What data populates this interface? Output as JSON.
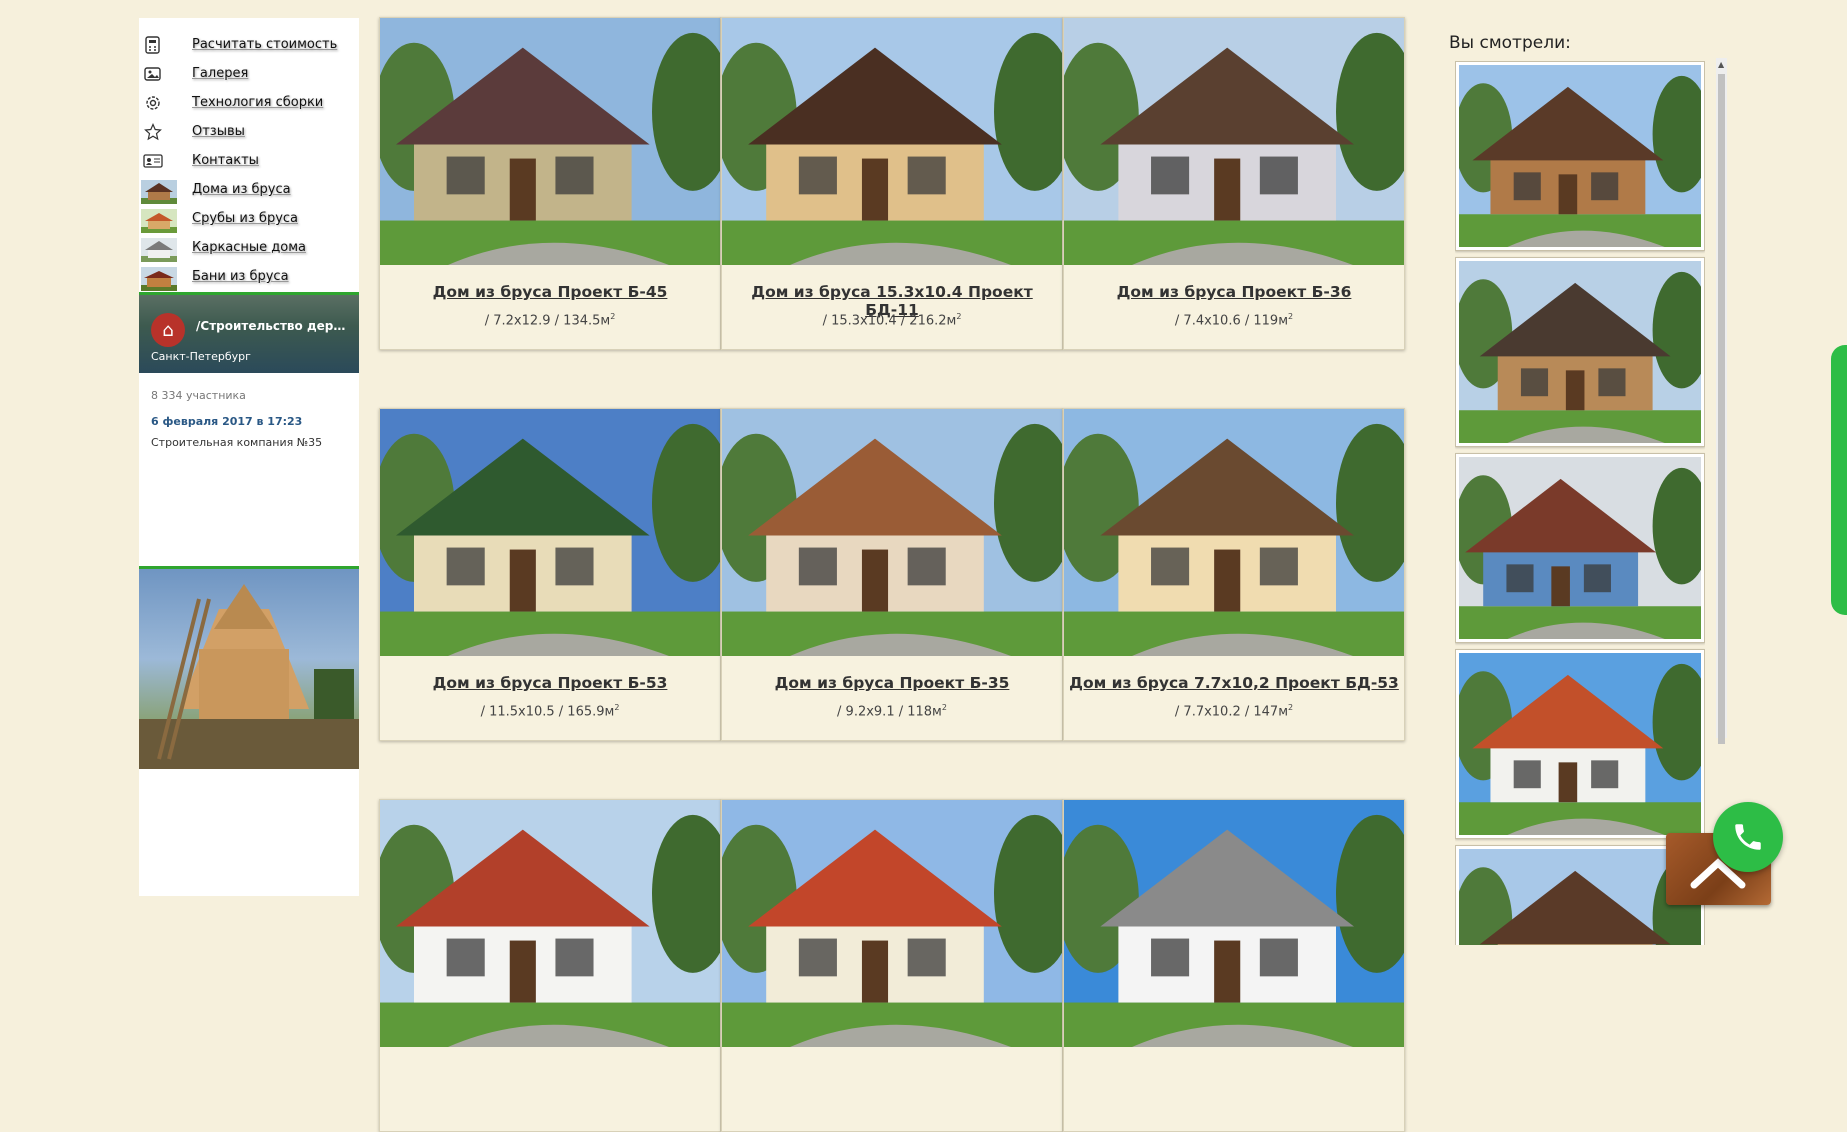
{
  "sidebar": {
    "menu": [
      {
        "label": "Расчитать стоимость",
        "icon": "calculator-icon"
      },
      {
        "label": "Галерея",
        "icon": "gallery-icon"
      },
      {
        "label": "Технология сборки",
        "icon": "gear-icon"
      },
      {
        "label": "Отзывы",
        "icon": "star-icon"
      },
      {
        "label": "Контакты",
        "icon": "contact-card-icon"
      },
      {
        "label": "Дома из бруса",
        "icon": "house-thumb-icon"
      },
      {
        "label": "Срубы из бруса",
        "icon": "house-thumb-icon"
      },
      {
        "label": "Каркасные дома",
        "icon": "house-thumb-icon"
      },
      {
        "label": "Бани из бруса",
        "icon": "house-thumb-icon"
      }
    ],
    "vk_widget": {
      "title": "/Строительство деревянных домов",
      "city": "Санкт-Петербург",
      "members": "8 334 участника",
      "date": "6 февраля 2017 в 17:23",
      "company": "Строительная компания №35"
    }
  },
  "catalog": [
    {
      "title": "Дом из бруса Проект Б-45",
      "dims": "/ 7.2x12.9 / 134.5м",
      "unit_sup": "2",
      "roof": "#5b3b3b",
      "walls": "#c2b48a",
      "sky": "#8fb6dd"
    },
    {
      "title": "Дом из бруса 15.3x10.4 Проект БД-11",
      "dims": "/ 15.3x10.4 / 216.2м",
      "unit_sup": "2",
      "roof": "#4a2f22",
      "walls": "#e0c08a",
      "sky": "#a8c8e8"
    },
    {
      "title": "Дом из бруса Проект Б-36",
      "dims": "/ 7.4x10.6 / 119м",
      "unit_sup": "2",
      "roof": "#5a4030",
      "walls": "#d8d6dc",
      "sky": "#b8cfe6"
    },
    {
      "title": "Дом из бруса Проект Б-53",
      "dims": "/ 11.5x10.5 / 165.9м",
      "unit_sup": "2",
      "roof": "#2f5a2f",
      "walls": "#e8dcb8",
      "sky": "#4d7fc6"
    },
    {
      "title": "Дом из бруса Проект Б-35",
      "dims": "/ 9.2x9.1 / 118м",
      "unit_sup": "2",
      "roof": "#9a5c36",
      "walls": "#e8d8c0",
      "sky": "#9fc1e2"
    },
    {
      "title": "Дом из бруса 7.7x10,2 Проект БД-53",
      "dims": "/ 7.7x10.2 / 147м",
      "unit_sup": "2",
      "roof": "#6a4a30",
      "walls": "#f0dcb0",
      "sky": "#8db8e2"
    },
    {
      "title": "",
      "dims": "",
      "unit_sup": "",
      "roof": "#b2402a",
      "walls": "#f4f4f2",
      "sky": "#b8d2ea"
    },
    {
      "title": "",
      "dims": "",
      "unit_sup": "",
      "roof": "#c2462a",
      "walls": "#f2ecd8",
      "sky": "#8fb8e6"
    },
    {
      "title": "",
      "dims": "",
      "unit_sup": "",
      "roof": "#8a8a8a",
      "walls": "#f4f4f4",
      "sky": "#3a8ad8"
    }
  ],
  "viewed": {
    "title": "Вы смотрели:",
    "items": [
      {
        "roof": "#5a3a28",
        "walls": "#b07a48",
        "sky": "#9cc2e8"
      },
      {
        "roof": "#4a3a30",
        "walls": "#b88a58",
        "sky": "#b8d0e6"
      },
      {
        "roof": "#7a3a2a",
        "walls": "#5a8ac0",
        "sky": "#d8dde2"
      },
      {
        "roof": "#c2502a",
        "walls": "#f2f2ee",
        "sky": "#5aa0e0"
      },
      {
        "roof": "#5a3a28",
        "walls": "#e0c08a",
        "sky": "#a8c8e8"
      }
    ]
  },
  "colors": {
    "background": "#f6f0dc",
    "accent_green": "#2fa52f",
    "call_green": "#2dbd46"
  }
}
